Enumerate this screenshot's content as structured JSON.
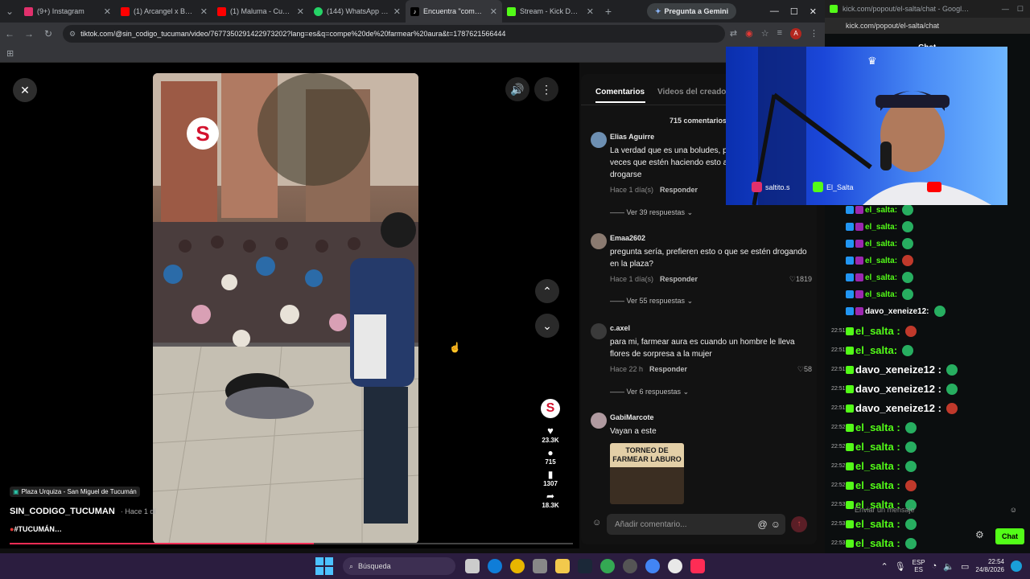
{
  "tabs": [
    {
      "label": "(9+) Instagram",
      "color": "#e1306c"
    },
    {
      "label": "(1) Arcangel x Bad B…",
      "color": "#ff0000"
    },
    {
      "label": "(1) Maluma - Cuatro…",
      "color": "#ff0000"
    },
    {
      "label": "(144) WhatsApp Bus…",
      "color": "#25d366"
    },
    {
      "label": "Encuentra \"compe…",
      "color": "#ffffff"
    },
    {
      "label": "Stream - Kick Dashb…",
      "color": "#53fc18"
    }
  ],
  "gemini_label": "Pregunta a Gemini",
  "url": "tiktok.com/@sin_codigo_tucuman/video/7677350291422973202?lang=es&q=compe%20de%20farmear%20aura&t=1787621566444",
  "kick": {
    "title": "kick.com/popout/el-salta/chat - Googl…",
    "address": "kick.com/popout/el-salta/chat",
    "chat_label": "Chat",
    "input_placeholder": "Enviar un mensaje",
    "chat_button": "Chat"
  },
  "video": {
    "location": "Plaza Urquiza - San Miguel de Tucumán",
    "author": "SIN_CODIGO_TUCUMAN",
    "posted": "· Hace 1 dí",
    "hashtag": "#TUCUMÁN…",
    "likes": "23.3K",
    "comments": "715",
    "saves": "1307",
    "shares": "18.3K"
  },
  "comments_panel": {
    "tab_comments": "Comentarios",
    "tab_videos": "Videos del creador",
    "count": "715 comentarios",
    "reply_label": "Responder",
    "input_placeholder": "Añadir comentario...",
    "items": [
      {
        "user": "Elias Aguirre",
        "text": "La verdad que es una boludes, pero prefiero estas veces que estén haciendo esto a que salgan a robar y a drogarse",
        "time": "Hace 1 día(s)",
        "likes": "",
        "more": "Ver 39 respuestas"
      },
      {
        "user": "Emaa2602",
        "text": "pregunta sería, prefieren esto o que se estén drogando en la plaza?",
        "time": "Hace 1 día(s)",
        "likes": "1819",
        "more": "Ver 55 respuestas"
      },
      {
        "user": "c.axel",
        "text": "para mi, farmear aura es cuando un hombre le lleva flores de sorpresa a la mujer",
        "time": "Hace 22 h",
        "likes": "58",
        "more": "Ver 6 respuestas"
      },
      {
        "user": "GabiMarcote",
        "text": "Vayan a este",
        "time": "",
        "likes": "",
        "more": ""
      }
    ],
    "poster_text": "TORNEO DE FARMEAR LABURO"
  },
  "cam": {
    "instagram": "saltito.s",
    "kick": "El_Salta"
  },
  "chat": [
    {
      "ts": "",
      "user": "el_salta:",
      "color": "#53fc18"
    },
    {
      "ts": "",
      "user": "el_salta:",
      "color": "#53fc18"
    },
    {
      "ts": "",
      "user": "el_salta:",
      "color": "#53fc18"
    },
    {
      "ts": "",
      "user": "el_salta:",
      "color": "#53fc18"
    },
    {
      "ts": "",
      "user": "el_salta:",
      "color": "#53fc18"
    },
    {
      "ts": "",
      "user": "el_salta:",
      "color": "#53fc18"
    },
    {
      "ts": "",
      "user": "davo_xeneize12:",
      "color": "#ffffff"
    },
    {
      "ts": "22:51",
      "user": "el_salta :",
      "color": "#53fc18"
    },
    {
      "ts": "22:51",
      "user": "el_salta:",
      "color": "#53fc18"
    },
    {
      "ts": "22:51",
      "user": "davo_xeneize12 :",
      "color": "#ffffff"
    },
    {
      "ts": "22:51",
      "user": "davo_xeneize12 :",
      "color": "#ffffff"
    },
    {
      "ts": "22:51",
      "user": "davo_xeneize12 :",
      "color": "#ffffff"
    },
    {
      "ts": "22:52",
      "user": "el_salta :",
      "color": "#53fc18"
    },
    {
      "ts": "22:52",
      "user": "el_salta :",
      "color": "#53fc18"
    },
    {
      "ts": "22:52",
      "user": "el_salta :",
      "color": "#53fc18"
    },
    {
      "ts": "22:52",
      "user": "el_salta :",
      "color": "#53fc18"
    },
    {
      "ts": "22:53",
      "user": "el_salta :",
      "color": "#53fc18"
    },
    {
      "ts": "22:53",
      "user": "el_salta :",
      "color": "#53fc18"
    },
    {
      "ts": "22:53",
      "user": "el_salta :",
      "color": "#53fc18"
    }
  ],
  "taskbar": {
    "search_label": "Búsqueda",
    "lang": "ESP",
    "lang2": "ES",
    "time": "22:54",
    "date": "24/8/2026"
  }
}
